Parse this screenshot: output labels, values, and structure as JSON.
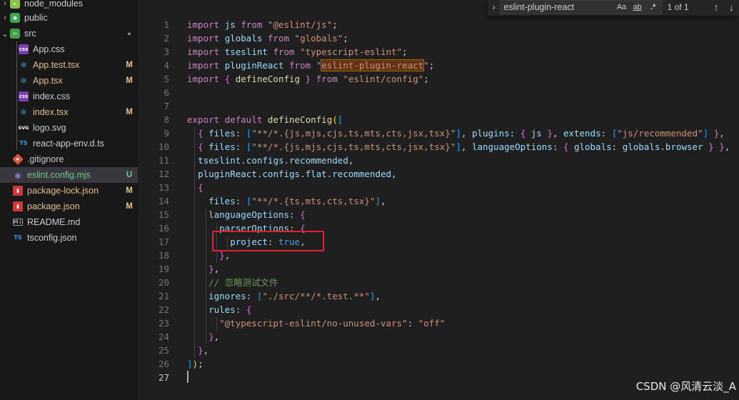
{
  "explorer": {
    "items": [
      {
        "label": "node_modules",
        "icon": "node-modules-folder-icon",
        "chevron": "›",
        "badge": ""
      },
      {
        "label": "public",
        "icon": "public-folder-icon",
        "chevron": "›",
        "badge": ""
      },
      {
        "label": "src",
        "icon": "src-folder-icon",
        "chevron": "⌄",
        "badge": ""
      },
      {
        "label": "App.css",
        "icon": "css-file-icon",
        "badge": ""
      },
      {
        "label": "App.test.tsx",
        "icon": "react-file-icon",
        "badge": "M"
      },
      {
        "label": "App.tsx",
        "icon": "react-file-icon",
        "badge": "M"
      },
      {
        "label": "index.css",
        "icon": "css-file-icon",
        "badge": ""
      },
      {
        "label": "index.tsx",
        "icon": "react-file-icon",
        "badge": "M"
      },
      {
        "label": "logo.svg",
        "icon": "svg-file-icon",
        "badge": ""
      },
      {
        "label": "react-app-env.d.ts",
        "icon": "ts-file-icon",
        "badge": ""
      },
      {
        "label": ".gitignore",
        "icon": "git-file-icon",
        "badge": ""
      },
      {
        "label": "eslint.config.mjs",
        "icon": "eslint-file-icon",
        "badge": "U"
      },
      {
        "label": "package-lock.json",
        "icon": "npm-file-icon",
        "badge": "M"
      },
      {
        "label": "package.json",
        "icon": "npm-file-icon",
        "badge": "M"
      },
      {
        "label": "README.md",
        "icon": "markdown-file-icon",
        "badge": ""
      },
      {
        "label": "tsconfig.json",
        "icon": "tsconfig-file-icon",
        "badge": ""
      }
    ]
  },
  "find": {
    "query": "eslint-plugin-react",
    "match_case": "Aa",
    "whole_word": "ab",
    "regex": ".*",
    "result_count": "1 of 1",
    "prev_icon": "arrow-up-icon",
    "next_icon": "arrow-down-icon"
  },
  "editor": {
    "line_numbers": [
      "1",
      "2",
      "3",
      "4",
      "5",
      "6",
      "7",
      "8",
      "9",
      "10",
      "11",
      "12",
      "13",
      "14",
      "15",
      "16",
      "17",
      "18",
      "19",
      "20",
      "21",
      "22",
      "23",
      "24",
      "25",
      "26",
      "27"
    ],
    "active_line": "27",
    "lines": [
      "import js from \"@eslint/js\";",
      "import globals from \"globals\";",
      "import tseslint from \"typescript-eslint\";",
      "import pluginReact from \"eslint-plugin-react\";",
      "import { defineConfig } from \"eslint/config\";",
      "",
      "",
      "export default defineConfig([",
      "  { files: [\"**/*.{js,mjs,cjs,ts,mts,cts,jsx,tsx}\"], plugins: { js }, extends: [\"js/recommended\"] },",
      "  { files: [\"**/*.{js,mjs,cjs,ts,mts,cts,jsx,tsx}\"], languageOptions: { globals: globals.browser } },",
      "  tseslint.configs.recommended,",
      "  pluginReact.configs.flat.recommended,",
      "  {",
      "    files: [\"**/*.{ts,mts,cts,tsx}\"],",
      "    languageOptions: {",
      "      parserOptions: {",
      "        project: true,",
      "      },",
      "    },",
      "    // 忽略测试文件",
      "    ignores: [\"./src/**/*.test.**\"],",
      "    rules: {",
      "      \"@typescript-eslint/no-unused-vars\": \"off\"",
      "    },",
      "  },",
      "]);",
      ""
    ]
  },
  "colors": {
    "keyword": "#c586c0",
    "string": "#ce9178",
    "variable": "#9cdcfe",
    "function": "#dcdcaa",
    "comment": "#6a9955",
    "highlight_box": "#e0202a",
    "modified": "#e2c08d",
    "untracked": "#73c991"
  },
  "watermark": "CSDN @风清云淡_A"
}
